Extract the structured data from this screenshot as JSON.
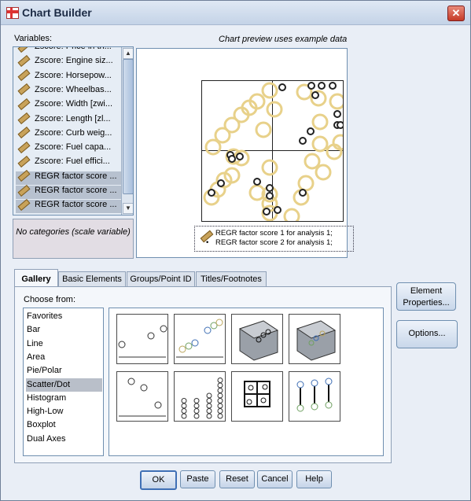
{
  "window": {
    "title": "Chart Builder",
    "close_glyph": "✕"
  },
  "variables": {
    "label": "Variables:",
    "items": [
      {
        "label": "Zscore:  Price in th..."
      },
      {
        "label": "Zscore:  Engine siz..."
      },
      {
        "label": "Zscore:  Horsepow..."
      },
      {
        "label": "Zscore:  Wheelbas..."
      },
      {
        "label": "Zscore:  Width [zwi..."
      },
      {
        "label": "Zscore:  Length [zl..."
      },
      {
        "label": "Zscore:  Curb weig..."
      },
      {
        "label": "Zscore:  Fuel capa..."
      },
      {
        "label": "Zscore:  Fuel effici..."
      },
      {
        "label": "REGR factor score ..."
      },
      {
        "label": "REGR factor score ..."
      },
      {
        "label": "REGR factor score ..."
      }
    ],
    "scroll_up": "▲",
    "scroll_down": "▼",
    "categories_text": "No categories (scale variable)"
  },
  "preview": {
    "caption": "Chart preview uses example data",
    "legend_line1": "REGR factor score 1 for analysis 1;",
    "legend_line2": "REGR factor score 2 for analysis 1;",
    "legend_bullet": "•",
    "point_color": "#e8d18a",
    "marker_color": "#222222"
  },
  "tabs": [
    {
      "label": "Gallery",
      "active": true
    },
    {
      "label": "Basic Elements",
      "active": false
    },
    {
      "label": "Groups/Point ID",
      "active": false
    },
    {
      "label": "Titles/Footnotes",
      "active": false
    }
  ],
  "gallery": {
    "choose_label": "Choose from:",
    "chart_types": [
      "Favorites",
      "Bar",
      "Line",
      "Area",
      "Pie/Polar",
      "Scatter/Dot",
      "Histogram",
      "High-Low",
      "Boxplot",
      "Dual Axes"
    ],
    "selected": "Scatter/Dot",
    "thumbnails": [
      {
        "icon": "simple-scatter-icon"
      },
      {
        "icon": "grouped-scatter-icon"
      },
      {
        "icon": "simple-3d-scatter-icon"
      },
      {
        "icon": "grouped-3d-scatter-icon"
      },
      {
        "icon": "summary-point-plot-icon"
      },
      {
        "icon": "simple-dot-plot-icon"
      },
      {
        "icon": "scatterplot-matrix-icon"
      },
      {
        "icon": "drop-line-icon"
      }
    ]
  },
  "side_buttons": {
    "element_properties": "Element Properties...",
    "options": "Options..."
  },
  "footer_buttons": {
    "ok": "OK",
    "paste": "Paste",
    "reset": "Reset",
    "cancel": "Cancel",
    "help": "Help"
  }
}
